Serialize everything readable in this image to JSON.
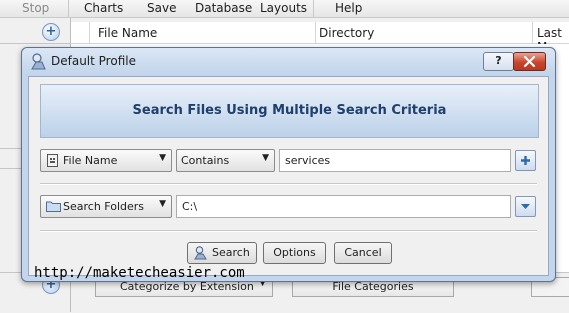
{
  "menu": {
    "items": [
      "Stop",
      "Charts",
      "Save",
      "Database",
      "Layouts",
      "Help"
    ]
  },
  "grid": {
    "columns": [
      "File Name",
      "Directory",
      "Last M"
    ]
  },
  "bottom": {
    "categorize_label": "Categorize by Extension",
    "categories_button": "File Categories"
  },
  "dialog": {
    "title": "Default Profile",
    "banner": "Search Files Using Multiple Search Criteria",
    "criteria": {
      "field": "File Name",
      "operator": "Contains",
      "value": "services"
    },
    "location": {
      "mode": "Search Folders",
      "path": "C:\\"
    },
    "buttons": {
      "search": "Search",
      "options": "Options",
      "cancel": "Cancel"
    },
    "help_glyph": "?"
  },
  "watermark": "http://maketecheasier.com",
  "colors": {
    "banner_text": "#1f3f6e",
    "dialog_frame": "#c4d6ec",
    "close_button": "#c9452c"
  },
  "icons": [
    "plus-icon",
    "file-icon",
    "folder-icon",
    "chevron-down-icon",
    "help-icon",
    "close-icon",
    "search-icon",
    "app-icon"
  ]
}
